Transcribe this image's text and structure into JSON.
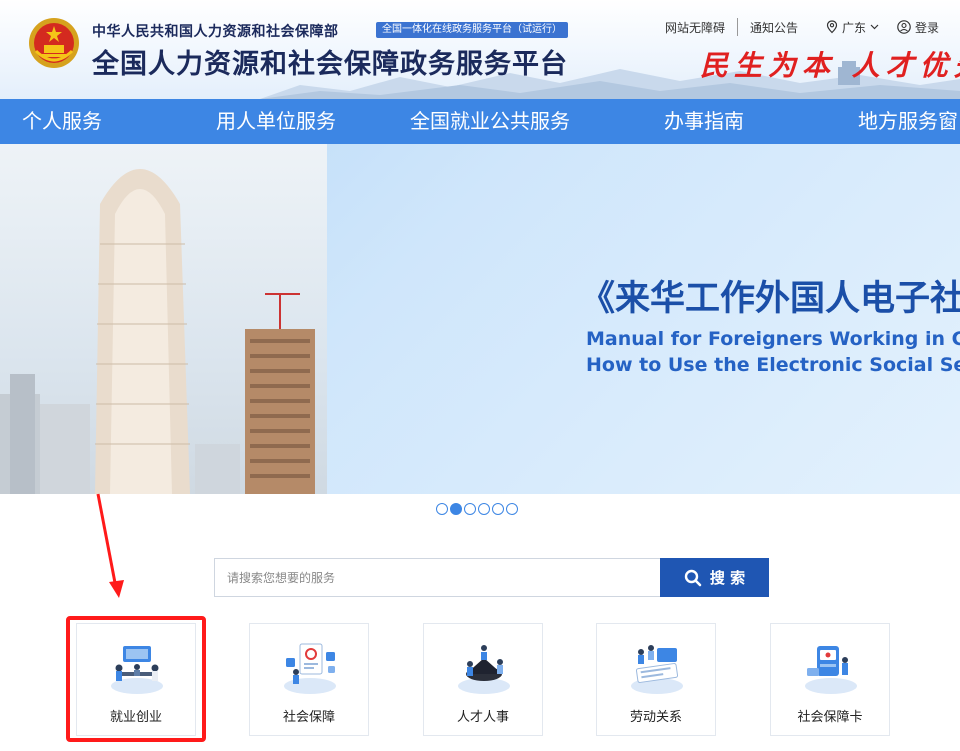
{
  "header": {
    "ministry": "中华人民共和国人力资源和社会保障部",
    "tag": "全国一体化在线政务服务平台（试运行）",
    "platform_title": "全国人力资源和社会保障政务服务平台",
    "slogan": "民生为本 人才优先",
    "links": {
      "accessibility": "网站无障碍",
      "notice": "通知公告",
      "location": "广东",
      "login": "登录"
    }
  },
  "nav": {
    "items": [
      "个人服务",
      "用人单位服务",
      "全国就业公共服务",
      "办事指南",
      "地方服务窗"
    ]
  },
  "banner": {
    "title": "《来华工作外国人电子社",
    "subtitle_line1": "Manual for Foreigners Working in Chi",
    "subtitle_line2": "How to Use the Electronic Social Secu",
    "dot_count": 6,
    "active_dot": 1
  },
  "search": {
    "placeholder": "请搜索您想要的服务",
    "button_label": "搜 索"
  },
  "services": [
    {
      "label": "就业创业",
      "icon": "employment-icon"
    },
    {
      "label": "社会保障",
      "icon": "social-security-icon"
    },
    {
      "label": "人才人事",
      "icon": "talent-icon"
    },
    {
      "label": "劳动关系",
      "icon": "labor-relations-icon"
    },
    {
      "label": "社会保障卡",
      "icon": "social-security-card-icon"
    }
  ],
  "colors": {
    "nav_blue": "#3d86e4",
    "title_navy": "#1b2a5c",
    "slogan_red": "#e02020",
    "search_button": "#1f56b3",
    "highlight_red": "#ff1a1a"
  }
}
